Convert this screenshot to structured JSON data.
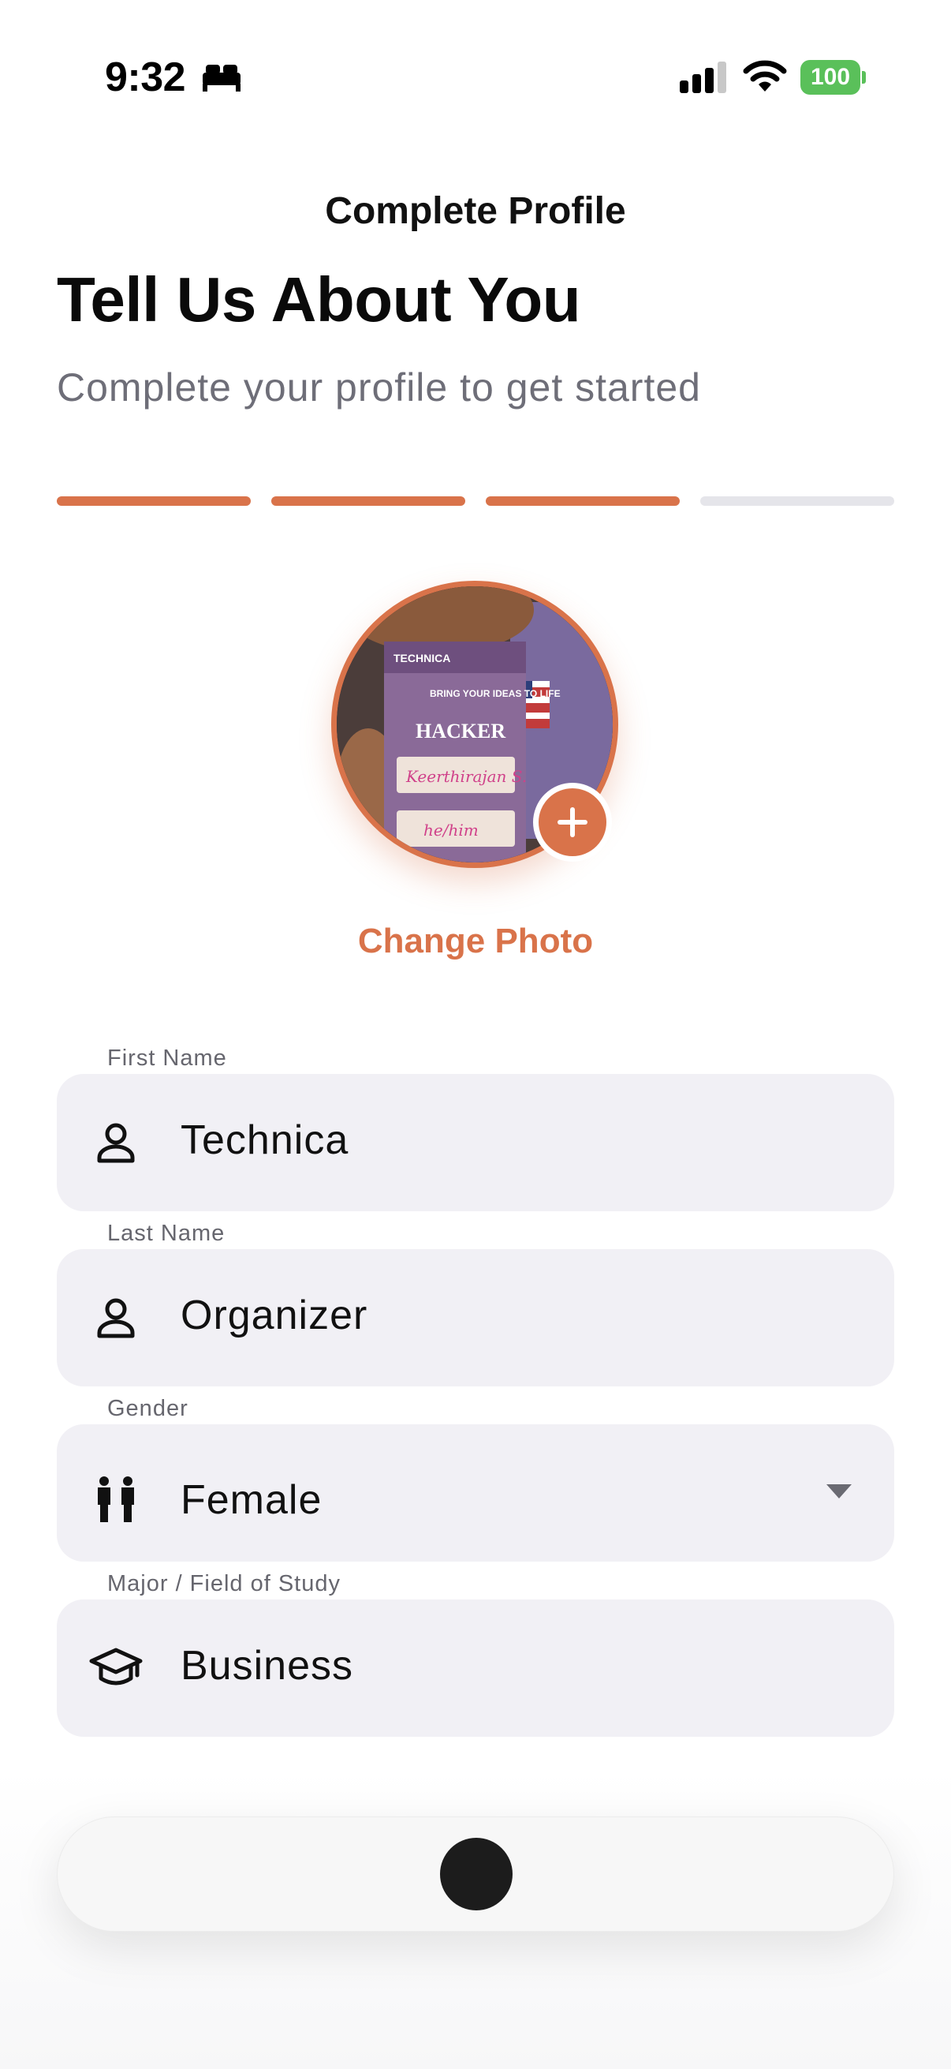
{
  "status_bar": {
    "time": "9:32",
    "battery": "100",
    "icons": [
      "bed-icon",
      "signal-icon",
      "wifi-icon",
      "battery-icon"
    ]
  },
  "header": {
    "nav_title": "Complete Profile",
    "heading": "Tell Us About You",
    "subheading": "Complete your profile to get started"
  },
  "progress": {
    "total_steps": 4,
    "completed_steps": 3,
    "accent_color": "#d9734a",
    "inactive_color": "#e5e5ea"
  },
  "photo": {
    "badge_lines": [
      "TECHNICA",
      "BRING YOUR IDEAS TO LIFE",
      "HACKER",
      "Keerthirajan S.",
      "he/him"
    ],
    "add_icon": "plus-icon",
    "change_label": "Change Photo"
  },
  "form": {
    "first_name": {
      "label": "First Name",
      "value": "Technica",
      "icon": "person-icon"
    },
    "last_name": {
      "label": "Last Name",
      "value": "Organizer",
      "icon": "person-icon"
    },
    "gender": {
      "label": "Gender",
      "value": "Female",
      "icon": "people-icon"
    },
    "major": {
      "label": "Major / Field of Study",
      "value": "Business",
      "icon": "graduation-cap-icon"
    }
  },
  "colors": {
    "accent": "#d9734a",
    "field_bg": "#f1f0f5",
    "subtext": "#6e6e78"
  }
}
